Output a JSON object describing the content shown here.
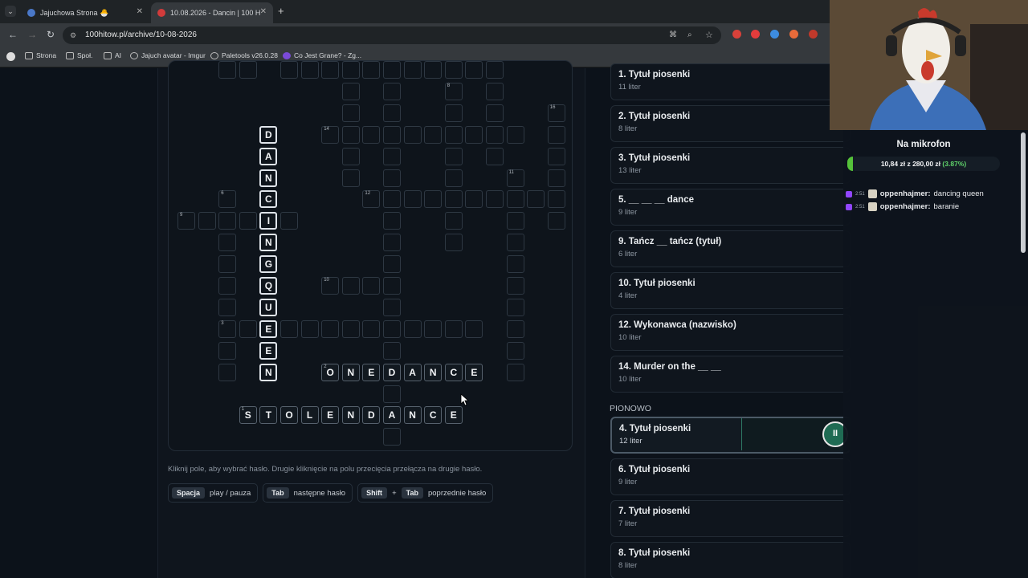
{
  "browser": {
    "tabs": [
      {
        "title": "Jajuchowa Strona 🐣",
        "close": "✕"
      },
      {
        "title": "10.08.2026 - Dancin | 100 H",
        "close": "✕"
      }
    ],
    "new_tab": "+",
    "url": "100hitow.pl/archive/10-08-2026",
    "bookmarks": [
      "Strona",
      "Społ.",
      "AI",
      "Jajuch avatar - Imgur",
      "Paletools v26.0.28",
      "Co Jest Grane? - Zg..."
    ]
  },
  "crossword": {
    "hint": "Kliknij pole, aby wybrać hasło. Drugie kliknięcie na polu przecięcia przełącza na drugie hasło.",
    "shortcuts": [
      {
        "keys": [
          "Spacja"
        ],
        "label": "play / pauza"
      },
      {
        "keys": [
          "Tab"
        ],
        "label": "następne hasło"
      },
      {
        "keys": [
          "Shift",
          "Tab"
        ],
        "label": "poprzednie hasło",
        "joiner": "+"
      }
    ],
    "answers": {
      "vertical_4": "DANCINGQUEEN",
      "horizontal_2": "ONEDANCE",
      "horizontal_1": "STOLENDANCE"
    },
    "numbers": [
      "8",
      "16",
      "14",
      "11",
      "6",
      "12",
      "9",
      "10",
      "3",
      "2",
      "1"
    ]
  },
  "clues": {
    "horizontal": [
      {
        "title": "1. Tytuł piosenki",
        "sub": "11 liter"
      },
      {
        "title": "2. Tytuł piosenki",
        "sub": "8 liter"
      },
      {
        "title": "3. Tytuł piosenki",
        "sub": "13 liter"
      },
      {
        "title": "5. __ __ __ dance",
        "sub": "9 liter"
      },
      {
        "title": "9. Tańcz __ tańcz (tytuł)",
        "sub": "6 liter"
      },
      {
        "title": "10. Tytuł piosenki",
        "sub": "4 liter"
      },
      {
        "title": "12. Wykonawca (nazwisko)",
        "sub": "10 liter"
      },
      {
        "title": "14. Murder on the __ __",
        "sub": "10 liter"
      }
    ],
    "vertical_heading": "PIONOWO",
    "vertical": [
      {
        "title": "4. Tytuł piosenki",
        "sub": "12 liter",
        "active": true
      },
      {
        "title": "6. Tytuł piosenki",
        "sub": "9 liter"
      },
      {
        "title": "7. Tytuł piosenki",
        "sub": "7 liter"
      },
      {
        "title": "8. Tytuł piosenki",
        "sub": "8 liter"
      }
    ],
    "pause_icon": "pause-icon"
  },
  "stream": {
    "title": "Na mikrofon",
    "goal_current": "10,84 zł",
    "goal_joiner": "z",
    "goal_target": "280,00 zł",
    "goal_pct": "(3.87%)",
    "goal_fraction": 0.0387,
    "chat": [
      {
        "time": "2:51",
        "user": "oppenhajmer:",
        "text": "dancing queen"
      },
      {
        "time": "2:51",
        "user": "oppenhajmer:",
        "text": "baranie"
      }
    ]
  }
}
